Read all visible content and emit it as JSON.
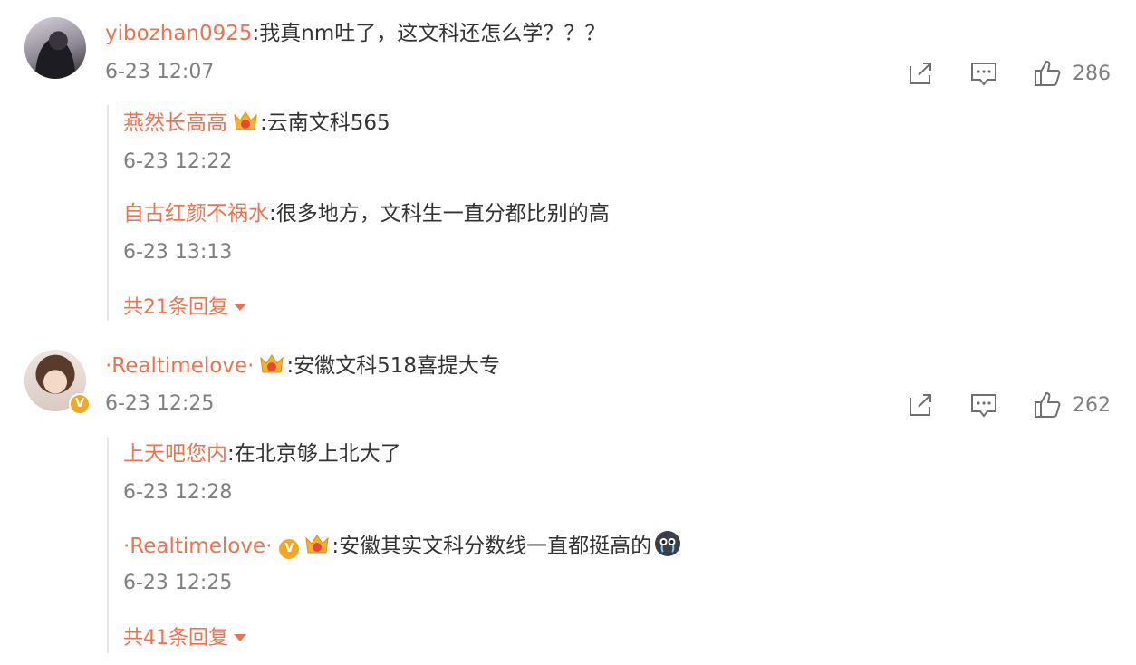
{
  "comments": [
    {
      "username": "yibozhan0925",
      "text": ":我真nm吐了，这文科还怎么学？？？",
      "time": "6-23 12:07",
      "likes": "286",
      "replies": [
        {
          "username": "燕然长高高",
          "text": ":云南文科565",
          "time": "6-23 12:22"
        },
        {
          "username": "自古红颜不祸水",
          "text": ":很多地方，文科生一直分都比别的高",
          "time": "6-23 13:13"
        }
      ],
      "more_replies": "共21条回复"
    },
    {
      "username": "·Realtimelove·",
      "text": ":安徽文科518喜提大专",
      "time": "6-23 12:25",
      "likes": "262",
      "replies": [
        {
          "username": "上天吧您内",
          "text": ":在北京够上北大了",
          "time": "6-23 12:28"
        },
        {
          "username": "·Realtimelove·",
          "text": ":安徽其实文科分数线一直都挺高的",
          "time": "6-23 12:25"
        }
      ],
      "more_replies": "共41条回复"
    }
  ],
  "icons": {
    "share": "share-icon",
    "comment": "comment-icon",
    "like": "thumbs-up-icon",
    "crown": "crown-badge-icon",
    "verified": "verified-v-icon",
    "emoji": "crying-emoji-icon"
  },
  "colors": {
    "username": "#eb7350",
    "text": "#333333",
    "meta": "#808080",
    "verified": "#f5a623"
  }
}
